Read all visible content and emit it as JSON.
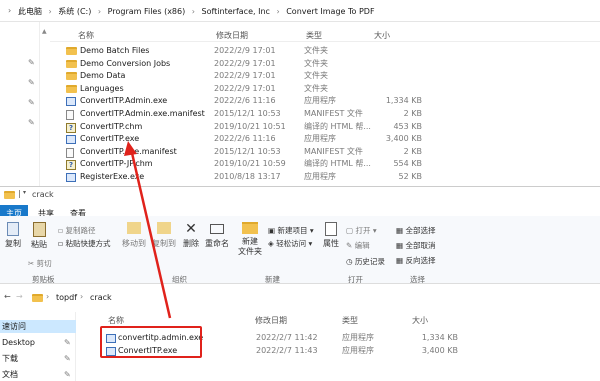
{
  "top": {
    "breadcrumb": [
      "此电脑",
      "系统 (C:)",
      "Program Files (x86)",
      "Softinterface, Inc",
      "Convert Image To PDF"
    ],
    "columns": {
      "name": "名称",
      "date": "修改日期",
      "type": "类型",
      "size": "大小"
    },
    "files": [
      {
        "name": "Demo Batch Files",
        "date": "2022/2/9 17:01",
        "type": "文件夹",
        "size": "",
        "icon": "folder-icon"
      },
      {
        "name": "Demo Conversion Jobs",
        "date": "2022/2/9 17:01",
        "type": "文件夹",
        "size": "",
        "icon": "folder-icon"
      },
      {
        "name": "Demo Data",
        "date": "2022/2/9 17:01",
        "type": "文件夹",
        "size": "",
        "icon": "folder-icon"
      },
      {
        "name": "Languages",
        "date": "2022/2/9 17:01",
        "type": "文件夹",
        "size": "",
        "icon": "folder-icon"
      },
      {
        "name": "ConvertITP.Admin.exe",
        "date": "2022/2/6 11:16",
        "type": "应用程序",
        "size": "1,334 KB",
        "icon": "exe-icon"
      },
      {
        "name": "ConvertITP.Admin.exe.manifest",
        "date": "2015/12/1 10:53",
        "type": "MANIFEST 文件",
        "size": "2 KB",
        "icon": "doc-icon"
      },
      {
        "name": "ConvertITP.chm",
        "date": "2019/10/21 10:51",
        "type": "编译的 HTML 帮...",
        "size": "453 KB",
        "icon": "chm-icon"
      },
      {
        "name": "ConvertITP.exe",
        "date": "2022/2/6 11:16",
        "type": "应用程序",
        "size": "3,400 KB",
        "icon": "exe-icon"
      },
      {
        "name": "ConvertITP.exe.manifest",
        "date": "2015/12/1 10:53",
        "type": "MANIFEST 文件",
        "size": "2 KB",
        "icon": "doc-icon"
      },
      {
        "name": "ConvertITP-JP.chm",
        "date": "2019/10/21 10:59",
        "type": "编译的 HTML 帮...",
        "size": "554 KB",
        "icon": "chm-icon"
      },
      {
        "name": "RegisterExe.exe",
        "date": "2010/8/18 13:17",
        "type": "应用程序",
        "size": "52 KB",
        "icon": "exe-icon"
      }
    ]
  },
  "bottom": {
    "window_title": "crack",
    "tabs": [
      "主页",
      "共享",
      "查看"
    ],
    "ribbon": {
      "copy": "复制",
      "paste": "粘贴",
      "copy_path": "复制路径",
      "paste_shortcut": "粘贴快捷方式",
      "cut": "剪切",
      "clipboard": "剪贴板",
      "move_to": "移动到",
      "copy_to": "复制到",
      "delete": "删除",
      "rename": "重命名",
      "organize": "组织",
      "new_item": "新建项目",
      "easy_access": "轻松访问",
      "new_folder": "新建\n文件夹",
      "new": "新建",
      "properties": "属性",
      "open": "打开",
      "edit": "编辑",
      "history": "历史记录",
      "open_group": "打开",
      "select_all": "全部选择",
      "select_none": "全部取消",
      "invert_selection": "反向选择",
      "select_group": "选择"
    },
    "path": [
      "topdf",
      "crack"
    ],
    "nav": [
      "速访问",
      "Desktop",
      "下载",
      "文档"
    ],
    "columns": {
      "name": "名称",
      "date": "修改日期",
      "type": "类型",
      "size": "大小"
    },
    "files": [
      {
        "name": "convertitp.admin.exe",
        "date": "2022/2/7 11:42",
        "type": "应用程序",
        "size": "1,334 KB"
      },
      {
        "name": "ConvertITP.exe",
        "date": "2022/2/7 11:43",
        "type": "应用程序",
        "size": "3,400 KB"
      }
    ]
  },
  "colors": {
    "arrow": "#e0221b",
    "highlight_box": "#e0221b",
    "selected_nav": "#cce8ff",
    "folder": "#f2c14e"
  }
}
